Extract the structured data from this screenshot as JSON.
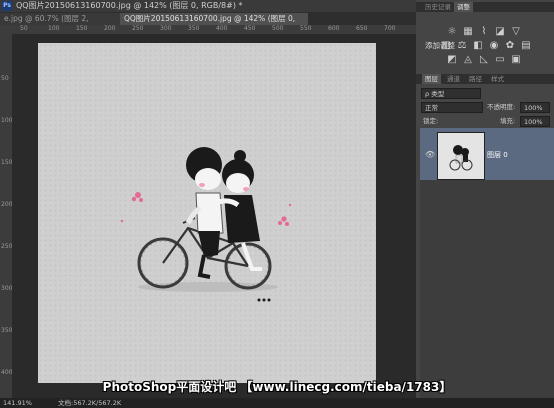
{
  "window": {
    "title": "QQ图片20150613160700.jpg @ 142% (图层 0, RGB/8#) *",
    "app_icon": "Ps",
    "controls": [
      "—",
      "□",
      "✕"
    ]
  },
  "tabs": [
    {
      "label": "e.jpg @ 60.7% (图层 2, RGB/8#) *",
      "close": "×",
      "active": false
    },
    {
      "label": "QQ图片20150613160700.jpg @ 142% (图层 0, RGB/8#) *",
      "close": "×",
      "active": true
    }
  ],
  "ruler": {
    "top": [
      "50",
      "100",
      "150",
      "200",
      "250",
      "300",
      "350",
      "400",
      "450",
      "500",
      "550",
      "600",
      "650",
      "700"
    ],
    "left": [
      "50",
      "100",
      "150",
      "200",
      "250",
      "300",
      "350",
      "400"
    ]
  },
  "status": {
    "zoom": "141.91%",
    "doc": "文档:567.2K/567.2K"
  },
  "right_panel": {
    "top_tabs": [
      "历史记录",
      "调整"
    ],
    "adjust_title": "添加调整",
    "adjust_icons": [
      "brightness-icon",
      "levels-icon",
      "curves-icon",
      "exposure-icon",
      "vibrance-icon",
      "hsl-icon",
      "color-balance-icon",
      "bw-icon",
      "photo-filter-icon",
      "channel-mixer-icon",
      "color-lookup-icon",
      "invert-icon",
      "posterize-icon",
      "threshold-icon",
      "gradient-map-icon",
      "selective-color-icon"
    ],
    "layers_tabs": [
      "图层",
      "通道",
      "路径",
      "样式"
    ],
    "filter_label": "ρ 类型",
    "blend_mode": "正常",
    "opacity_label": "不透明度:",
    "opacity_value": "100%",
    "lock_label": "锁定:",
    "fill_label": "填充:",
    "fill_value": "100%",
    "layer_name": "图层 0"
  },
  "watermark": "PhotoShop平面设计吧 【www.linecg.com/tieba/1783】",
  "colors": {
    "accent_selected": "#5b6a80",
    "panel": "#454545",
    "canvas": "#cfcfcf",
    "pink": "#e46a92"
  }
}
